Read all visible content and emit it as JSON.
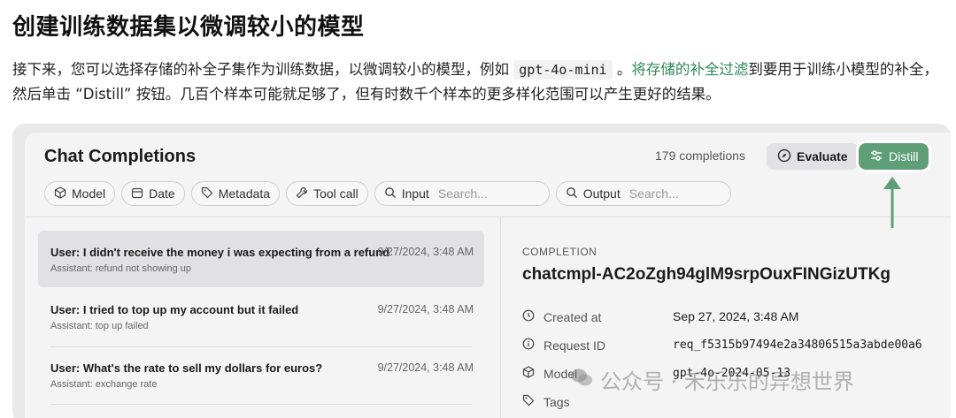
{
  "doc": {
    "title": "创建训练数据集以微调较小的模型",
    "para_1": "接下来，您可以选择存储的补全子集作为训练数据，以微调较小的模型，例如 ",
    "para_code": "gpt-4o-mini",
    "para_2": " 。",
    "para_link": "将存储的补全过滤",
    "para_3": "到要用于训练小模型的补全，然后单击 “Distill” 按钮。几百个样本可能就足够了，但有时数千个样本的更多样化范围可以产生更好的结果。"
  },
  "panel": {
    "title": "Chat Completions",
    "count": "179 completions",
    "evaluate_label": "Evaluate",
    "distill_label": "Distill"
  },
  "filters": {
    "model": "Model",
    "date": "Date",
    "metadata": "Metadata",
    "tool_call": "Tool call",
    "input_label": "Input",
    "input_placeholder": "Search...",
    "output_label": "Output",
    "output_placeholder": "Search..."
  },
  "rows": [
    {
      "user": "User: I didn't receive the money i was expecting from a refund",
      "assistant": "Assistant: refund not showing up",
      "time": "9/27/2024, 3:48 AM"
    },
    {
      "user": "User: I tried to top up my account but it failed",
      "assistant": "Assistant: top up failed",
      "time": "9/27/2024, 3:48 AM"
    },
    {
      "user": "User: What's the rate to sell my dollars for euros?",
      "assistant": "Assistant: exchange rate",
      "time": "9/27/2024, 3:48 AM"
    }
  ],
  "detail": {
    "label": "COMPLETION",
    "id": "chatcmpl-AC2oZgh94glM9srpOuxFINGizUTKg",
    "created_label": "Created at",
    "created_value": "Sep 27, 2024, 3:48 AM",
    "request_label": "Request ID",
    "request_value": "req_f5315b97494e2a34806515a3abde00a6",
    "model_label": "Model",
    "model_value": "gpt-4o-2024-05-13",
    "tags_label": "Tags"
  },
  "watermark": "公众号 · 禾乐乐的异想世界",
  "colors": {
    "accent": "#5e9f78",
    "link": "#2e8b57"
  }
}
